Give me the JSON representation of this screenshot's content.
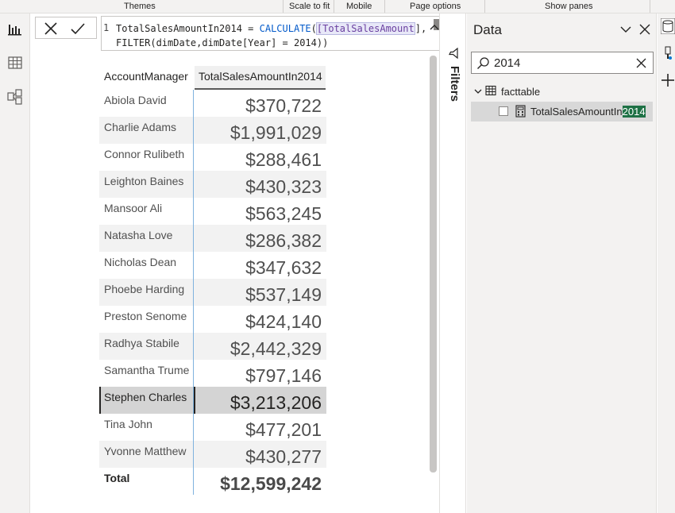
{
  "ribbon": {
    "themes": "Themes",
    "scale_to_fit": "Scale to fit",
    "mobile": "Mobile",
    "page_options": "Page options",
    "show_panes": "Show panes"
  },
  "left_rail": {
    "icons": [
      "report-view-icon",
      "table-view-icon",
      "model-view-icon"
    ]
  },
  "formula_bar": {
    "line_number": "1",
    "line1_a": "TotalSalesAmountIn2014 = ",
    "line1_kw": "CALCULATE",
    "line1_b": "(",
    "line1_ref": "[TotalSalesAmount",
    "line1_c": "],",
    "line2": "FILTER(dimDate,dimDate[Year] = 2014))"
  },
  "table": {
    "headers": {
      "account_manager": "AccountManager",
      "total_sales": "TotalSalesAmountIn2014"
    },
    "rows": [
      {
        "name": "Abiola David",
        "value": "$370,722"
      },
      {
        "name": "Charlie Adams",
        "value": "$1,991,029"
      },
      {
        "name": "Connor Rulibeth",
        "value": "$288,461"
      },
      {
        "name": "Leighton Baines",
        "value": "$430,323"
      },
      {
        "name": "Mansoor Ali",
        "value": "$563,245"
      },
      {
        "name": "Natasha Love",
        "value": "$286,382"
      },
      {
        "name": "Nicholas Dean",
        "value": "$347,632"
      },
      {
        "name": "Phoebe Harding",
        "value": "$537,149"
      },
      {
        "name": "Preston Senome",
        "value": "$424,140"
      },
      {
        "name": "Radhya Stabile",
        "value": "$2,442,329"
      },
      {
        "name": "Samantha Trume",
        "value": "$797,146"
      },
      {
        "name": "Stephen Charles",
        "value": "$3,213,206"
      },
      {
        "name": "Tina John",
        "value": "$477,201"
      },
      {
        "name": "Yvonne Matthew",
        "value": "$430,277"
      }
    ],
    "selected_row": "Stephen Charles",
    "total": {
      "label": "Total",
      "value": "$12,599,242"
    }
  },
  "filters_pane": {
    "label": "Filters"
  },
  "data_pane": {
    "title": "Data",
    "search_value": "2014",
    "table_name": "facttable",
    "field_prefix": "TotalSalesAmountIn",
    "field_match": "2014"
  },
  "colors": {
    "accent_blue": "#7fb2de",
    "search_highlight": "#1e7145",
    "selected_row": "#d4d4d4"
  }
}
